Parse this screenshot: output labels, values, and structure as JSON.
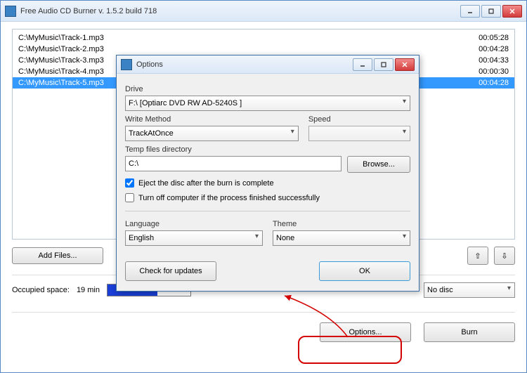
{
  "main": {
    "title": "Free Audio CD Burner  v. 1.5.2 build 718",
    "files": [
      {
        "path": "C:\\MyMusic\\Track-1.mp3",
        "duration": "00:05:28",
        "selected": false
      },
      {
        "path": "C:\\MyMusic\\Track-2.mp3",
        "duration": "00:04:28",
        "selected": false
      },
      {
        "path": "C:\\MyMusic\\Track-3.mp3",
        "duration": "00:04:33",
        "selected": false
      },
      {
        "path": "C:\\MyMusic\\Track-4.mp3",
        "duration": "00:00:30",
        "selected": false
      },
      {
        "path": "C:\\MyMusic\\Track-5.mp3",
        "duration": "00:04:28",
        "selected": true
      }
    ],
    "add_files_label": "Add Files...",
    "move_up_glyph": "⇧",
    "move_down_glyph": "⇩",
    "occupied_label": "Occupied space:",
    "occupied_value": "19 min",
    "drive_combo_value": "No disc",
    "options_label": "Options...",
    "burn_label": "Burn"
  },
  "dialog": {
    "title": "Options",
    "drive_label": "Drive",
    "drive_value": "F:\\ [Optiarc DVD RW AD-5240S ]",
    "write_method_label": "Write Method",
    "write_method_value": "TrackAtOnce",
    "speed_label": "Speed",
    "speed_value": "",
    "temp_label": "Temp files directory",
    "temp_value": "C:\\",
    "browse_label": "Browse...",
    "eject_label": "Eject the disc after the burn is complete",
    "eject_checked": true,
    "shutdown_label": "Turn off computer if the process finished successfully",
    "shutdown_checked": false,
    "language_label": "Language",
    "language_value": "English",
    "theme_label": "Theme",
    "theme_value": "None",
    "check_updates_label": "Check for updates",
    "ok_label": "OK"
  }
}
